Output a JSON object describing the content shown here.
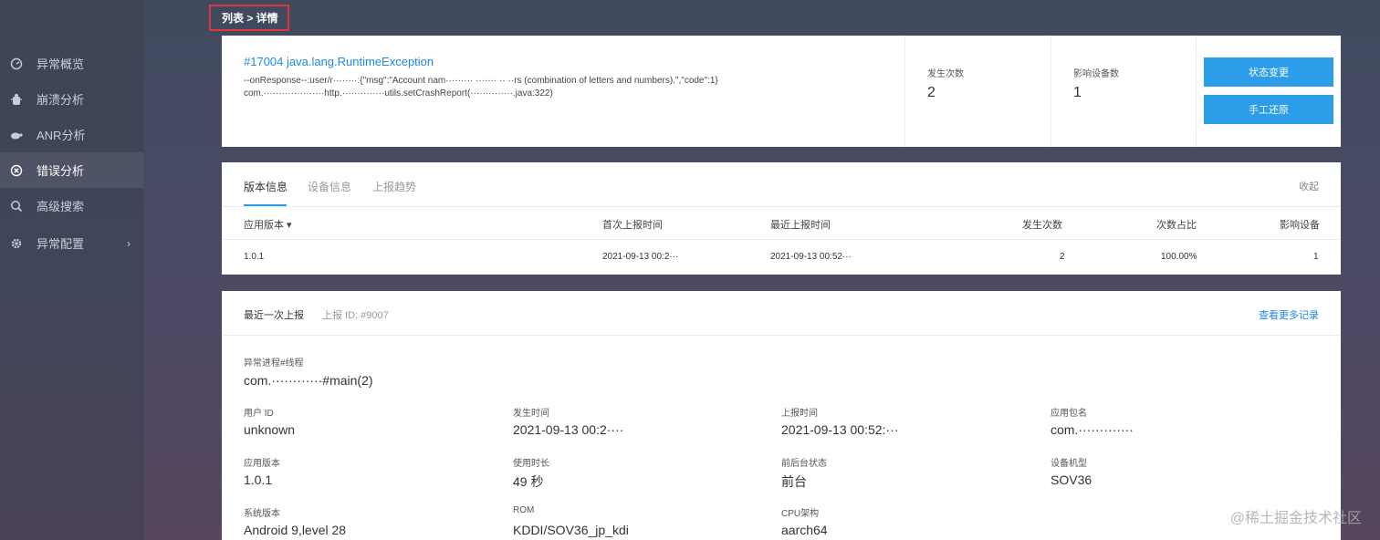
{
  "breadcrumb": "列表 > 详情",
  "sidebar": {
    "items": [
      {
        "label": "异常概览",
        "icon": "dashboard-icon"
      },
      {
        "label": "崩溃分析",
        "icon": "bug-icon"
      },
      {
        "label": "ANR分析",
        "icon": "tortoise-icon"
      },
      {
        "label": "错误分析",
        "icon": "error-circle-icon",
        "active": true
      },
      {
        "label": "高级搜索",
        "icon": "search-icon"
      },
      {
        "label": "异常配置",
        "icon": "gear-icon",
        "arrow": "›"
      }
    ]
  },
  "summary": {
    "title": "#17004 java.lang.RuntimeException",
    "line1": "--onResponse--:user/r········:{\"msg\":\"Account nam········· ······· ·· ··rs (combination of letters and numbers).\",\"code\":1}",
    "line2": "com.····················http.··············utils.setCrashReport(··············.java:322)",
    "occurrences_label": "发生次数",
    "occurrences_value": "2",
    "devices_label": "影响设备数",
    "devices_value": "1",
    "btn_status": "状态变更",
    "btn_restore": "手工还原"
  },
  "version": {
    "tabs": [
      "版本信息",
      "设备信息",
      "上报趋势"
    ],
    "collapse": "收起",
    "headers": [
      "应用版本 ▾",
      "首次上报时间",
      "最近上报时间",
      "发生次数",
      "次数占比",
      "影响设备"
    ],
    "row": [
      "1.0.1",
      "2021-09-13 00:2···",
      "2021-09-13 00:52···",
      "2",
      "100.00%",
      "1"
    ]
  },
  "latest": {
    "title": "最近一次上报",
    "report_id": "上报 ID:  #9007",
    "more": "查看更多记录",
    "process_label": "异常进程#线程",
    "process_value": "com.············#main(2)",
    "fields": [
      {
        "label": "用户 ID",
        "value": "unknown"
      },
      {
        "label": "发生时间",
        "value": "2021-09-13 00:2····"
      },
      {
        "label": "上报时间",
        "value": "2021-09-13 00:52:···"
      },
      {
        "label": "应用包名",
        "value": "com.·············"
      },
      {
        "label": "应用版本",
        "value": "1.0.1"
      },
      {
        "label": "使用时长",
        "value": "49 秒"
      },
      {
        "label": "前后台状态",
        "value": "前台"
      },
      {
        "label": "设备机型",
        "value": "SOV36"
      },
      {
        "label": "系统版本",
        "value": "Android 9,level 28"
      },
      {
        "label": "ROM",
        "value": "KDDI/SOV36_jp_kdi"
      },
      {
        "label": "CPU架构",
        "value": "aarch64"
      }
    ]
  },
  "watermark": "@稀土掘金技术社区"
}
